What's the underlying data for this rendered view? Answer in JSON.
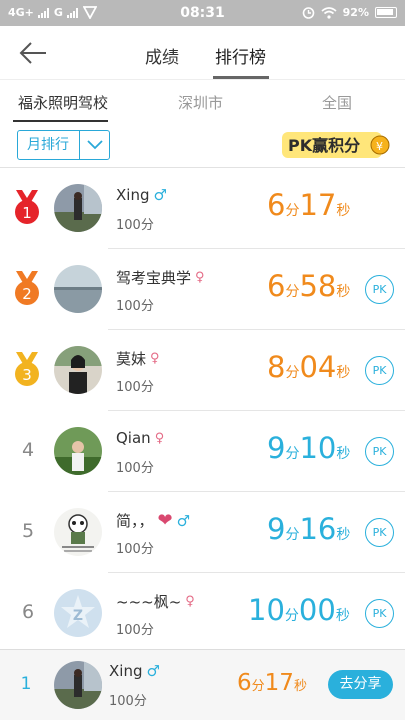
{
  "status_bar": {
    "network_left": "4G+",
    "network_right": "G",
    "time": "08:31",
    "battery": "92%"
  },
  "nav": {
    "tab_grade": "成绩",
    "tab_rank": "排行榜"
  },
  "subtabs": [
    "福永照明驾校",
    "深圳市",
    "全国"
  ],
  "filter": {
    "label": "月排行"
  },
  "banner": {
    "text": "PK赢积分"
  },
  "rows": [
    {
      "rank": "1",
      "name": "Xing",
      "gender": "♂",
      "score": "100分",
      "minutes": "6",
      "seconds": "17",
      "unit_min": "分",
      "unit_sec": "秒",
      "pk": ""
    },
    {
      "rank": "2",
      "name": "驾考宝典学",
      "gender": "♀",
      "score": "100分",
      "minutes": "6",
      "seconds": "58",
      "unit_min": "分",
      "unit_sec": "秒",
      "pk": "PK"
    },
    {
      "rank": "3",
      "name": "莫妹",
      "gender": "♀",
      "score": "100分",
      "minutes": "8",
      "seconds": "04",
      "unit_min": "分",
      "unit_sec": "秒",
      "pk": "PK"
    },
    {
      "rank": "4",
      "name": "Qian",
      "gender": "♀",
      "score": "100分",
      "minutes": "9",
      "seconds": "10",
      "unit_min": "分",
      "unit_sec": "秒",
      "pk": "PK"
    },
    {
      "rank": "5",
      "name": "简，，",
      "gender": "♂",
      "score": "100分",
      "minutes": "9",
      "seconds": "16",
      "unit_min": "分",
      "unit_sec": "秒",
      "pk": "PK"
    },
    {
      "rank": "6",
      "name": "~~~枫~",
      "gender": "♀",
      "score": "100分",
      "minutes": "10",
      "seconds": "00",
      "unit_min": "分",
      "unit_sec": "秒",
      "pk": "PK"
    }
  ],
  "footer": {
    "rank": "1",
    "name": "Xing",
    "gender": "♂",
    "score": "100分",
    "minutes": "6",
    "seconds": "17",
    "unit_min": "分",
    "unit_sec": "秒",
    "share": "去分享"
  },
  "colors": {
    "accent": "#2ab0dc",
    "gold_time": "#f08a1c",
    "medal_1": "#e5242a",
    "medal_2": "#f07a24",
    "medal_3": "#f2b320"
  }
}
